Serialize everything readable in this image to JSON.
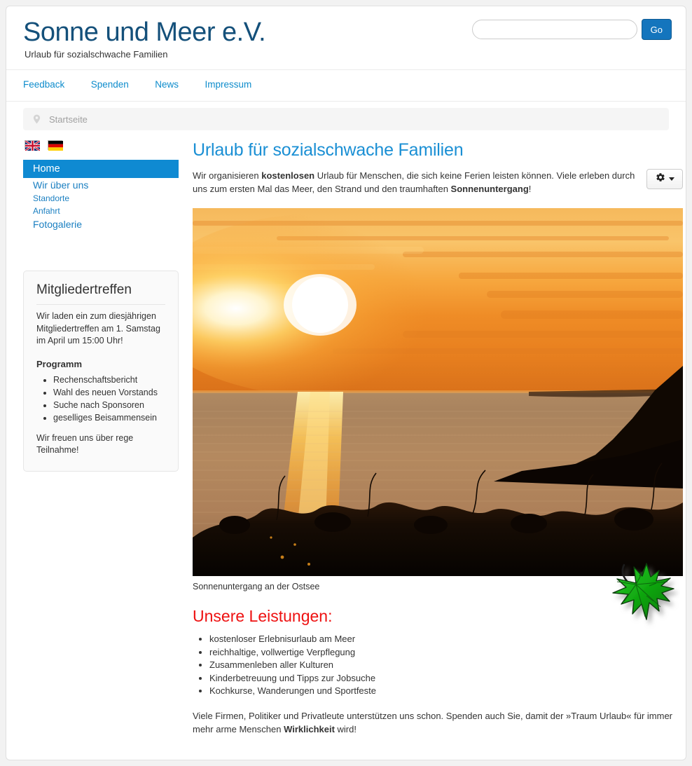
{
  "header": {
    "title": "Sonne und Meer e.V.",
    "subtitle": "Urlaub für sozialschwache Familien",
    "search_placeholder": "",
    "search_value": "",
    "go_label": "Go"
  },
  "topnav": {
    "items": [
      {
        "label": "Feedback"
      },
      {
        "label": "Spenden"
      },
      {
        "label": "News"
      },
      {
        "label": "Impressum"
      }
    ]
  },
  "breadcrumb": {
    "icon": "map-pin-icon",
    "text": "Startseite"
  },
  "sidebar": {
    "flags": [
      {
        "name": "flag-uk",
        "title": "English"
      },
      {
        "name": "flag-de",
        "title": "Deutsch"
      }
    ],
    "nav": [
      {
        "label": "Home",
        "active": true
      },
      {
        "label": "Wir über uns",
        "active": false
      },
      {
        "label": "Standorte",
        "active": false
      },
      {
        "label": "Anfahrt",
        "active": false
      },
      {
        "label": "Fotogalerie",
        "active": false
      }
    ],
    "box": {
      "heading": "Mitgliedertreffen",
      "paragraph": "Wir laden ein zum diesjährigen Mitgliedertreffen am 1. Samstag im April um 15:00 Uhr!",
      "subheading": "Programm",
      "items": [
        "Rechenschaftsbericht",
        "Wahl des neuen Vorstands",
        "Suche nach Sponsoren",
        "geselliges Beisammensein"
      ],
      "closing": "Wir freuen uns über rege Teilnahme!"
    }
  },
  "main": {
    "title": "Urlaub für sozialschwache Familien",
    "intro": {
      "part1": "Wir organisieren ",
      "bold1": "kostenlosen",
      "part2": " Urlaub für Menschen, die sich keine Ferien leisten können. Viele erleben durch uns zum ersten Mal das Meer, den Strand und den traumhaften ",
      "bold2": "Sonnenuntergang",
      "part3": "!"
    },
    "gear_button": {
      "icon": "gear-icon",
      "caret": "chevron-down-icon"
    },
    "hero": {
      "alt": "Sonnenuntergang über dem Meer",
      "caption": "Sonnenuntergang an der Ostsee"
    },
    "services_title": "Unsere Leistungen:",
    "services": [
      "kostenloser Erlebnisurlaub am Meer",
      "reichhaltige, vollwertige Verpflegung",
      "Zusammenleben aller Kulturen",
      "Kinderbetreuung und Tipps zur Jobsuche",
      "Kochkurse, Wanderungen und Sportfeste"
    ],
    "closing": {
      "part1": "Viele Firmen, Politiker und Privatleute unterstützen uns schon. Spenden auch Sie, damit der »Traum Urlaub« für immer mehr arme Menschen ",
      "bold1": "Wirklichkeit",
      "part2": " wird!"
    },
    "leaf": {
      "alt": "grünes Ahornblatt"
    }
  },
  "colors": {
    "title_blue": "#14507a",
    "link_blue": "#0e8ccc",
    "accent_blue": "#0f8ad2",
    "heading_blue": "#1a8fd4",
    "services_red": "#ee1111",
    "go_button": "#1475bd"
  }
}
